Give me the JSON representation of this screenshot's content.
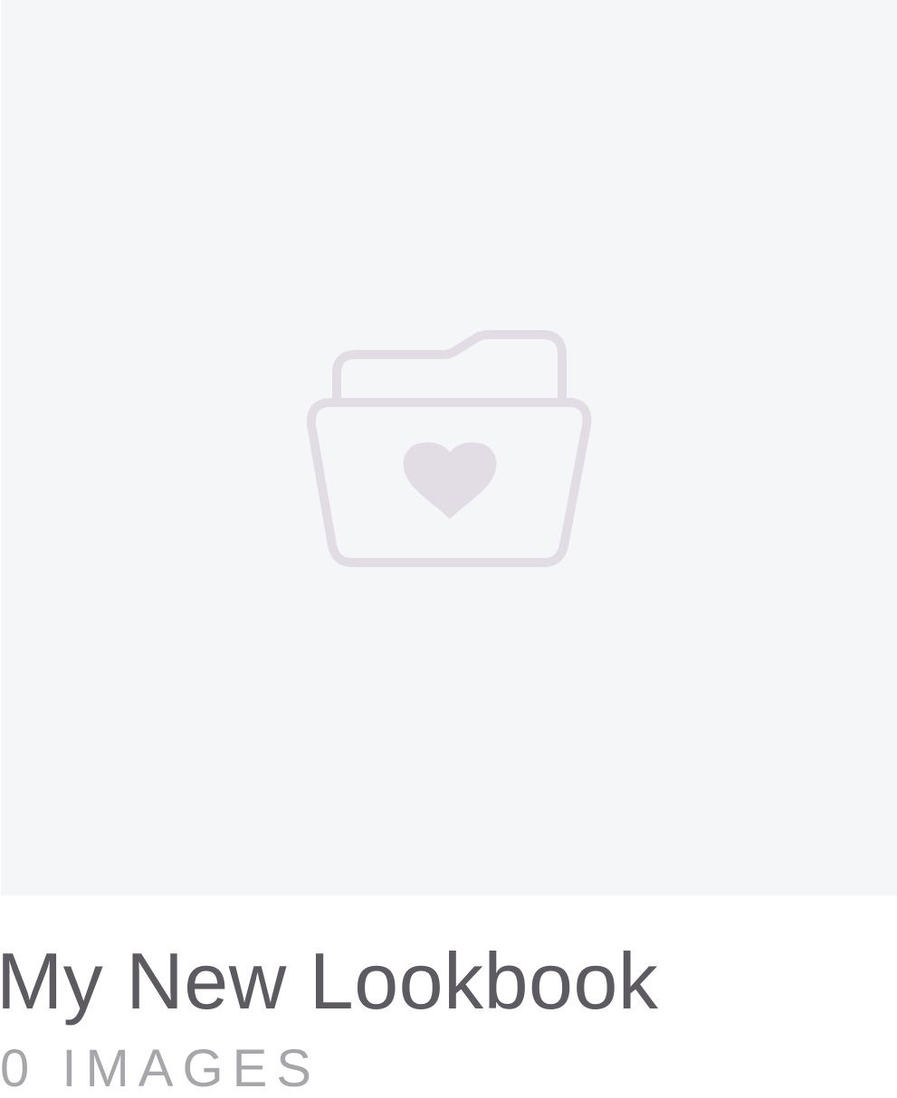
{
  "lookbook": {
    "title": "My New Lookbook",
    "image_count": "0 IMAGES",
    "thumbnail_icon": "folder-heart-icon",
    "colors": {
      "thumbnail_background": "#f5f6f8",
      "icon_color": "#e2dde4",
      "title_color": "#5d5b61",
      "count_color": "#a7a6aa"
    }
  }
}
